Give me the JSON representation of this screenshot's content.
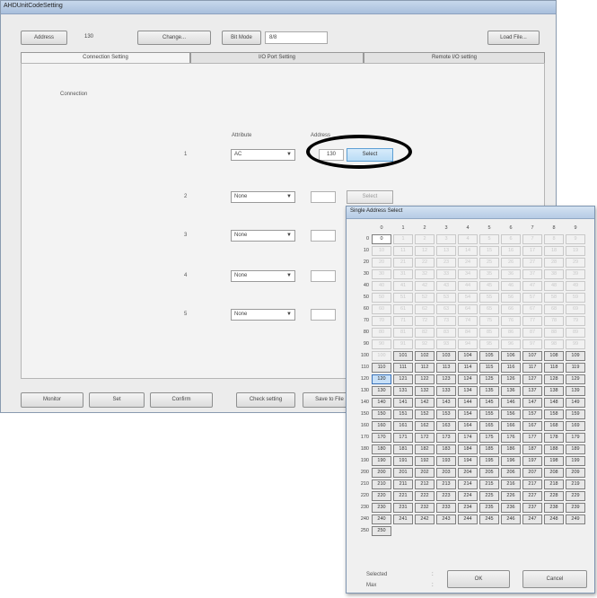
{
  "window": {
    "title": "AHDUnitCodeSetting"
  },
  "header": {
    "address_btn": "Address",
    "address_value": "130",
    "change_btn": "Change...",
    "bit_mode_btn": "Bit Mode",
    "bit_mode_value": "8/8",
    "load_file_btn": "Load File..."
  },
  "tabs": [
    "Connection Setting",
    "I/O Port Setting",
    "Remote I/O setting"
  ],
  "connection": {
    "label": "Connection",
    "col_attribute": "Attribute",
    "col_address": "Address",
    "rows": [
      {
        "num": "1",
        "attr": "AC",
        "addr": "130",
        "select": "Select"
      },
      {
        "num": "2",
        "attr": "None",
        "addr": "",
        "select": "Select"
      },
      {
        "num": "3",
        "attr": "None",
        "addr": "",
        "select": ""
      },
      {
        "num": "4",
        "attr": "None",
        "addr": "",
        "select": ""
      },
      {
        "num": "5",
        "attr": "None",
        "addr": "",
        "select": ""
      }
    ]
  },
  "bottom": {
    "monitor": "Monitor",
    "set": "Set",
    "confirm": "Confirm",
    "check_setting": "Check setting",
    "save_to_file": "Save to File"
  },
  "dialog": {
    "title": "Single Address Select",
    "col_headers": [
      "0",
      "1",
      "2",
      "3",
      "4",
      "5",
      "6",
      "7",
      "8",
      "9"
    ],
    "row_headers": [
      "0",
      "10",
      "20",
      "30",
      "40",
      "50",
      "60",
      "70",
      "80",
      "90",
      "100",
      "110",
      "120",
      "130",
      "140",
      "150",
      "160",
      "170",
      "180",
      "190",
      "200",
      "210",
      "220",
      "230",
      "240",
      "250"
    ],
    "first_active": 101,
    "max_value": 250,
    "current_value": 120,
    "selected_label": "Selected",
    "selected_sep": ":",
    "max_label": "Max",
    "max_sep": ":",
    "ok": "OK",
    "cancel": "Cancel"
  }
}
